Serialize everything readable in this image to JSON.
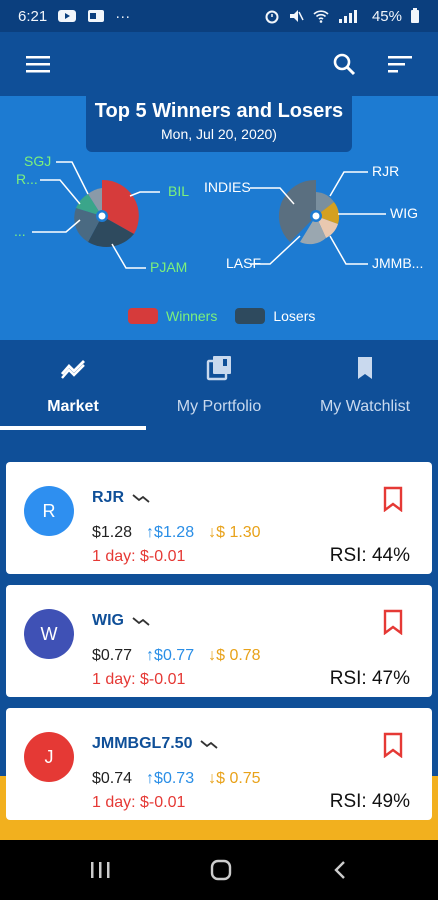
{
  "status": {
    "time": "6:21",
    "dots": "···",
    "battery": "45%"
  },
  "banner": {
    "title": "Top 5 Winners and Losers",
    "subtitle": "Mon, Jul 20, 2020)",
    "winners_labels": [
      "SGJ",
      "R...",
      "...",
      "BIL",
      "PJAM"
    ],
    "losers_labels": [
      "INDIES",
      "LASF",
      "RJR",
      "WIG",
      "JMMB..."
    ],
    "legend": [
      {
        "label": "Winners",
        "color": "#d63b3b",
        "text_color": "#7cf07c"
      },
      {
        "label": "Losers",
        "color": "#2e4a5e",
        "text_color": "#ffffff"
      }
    ]
  },
  "tabs": [
    {
      "label": "Market",
      "icon": "trending-icon",
      "active": true
    },
    {
      "label": "My Portfolio",
      "icon": "portfolio-icon",
      "active": false
    },
    {
      "label": "My Watchlist",
      "icon": "bookmark-icon",
      "active": false
    }
  ],
  "stocks": [
    {
      "initial": "R",
      "avatar_color": "#2e8ff0",
      "symbol": "RJR",
      "price": "$1.28",
      "up": "↑$1.28",
      "down": "↓$ 1.30",
      "change": "1 day: $-0.01",
      "rsi": "RSI: 44%"
    },
    {
      "initial": "W",
      "avatar_color": "#3f51b5",
      "symbol": "WIG",
      "price": "$0.77",
      "up": "↑$0.77",
      "down": "↓$ 0.78",
      "change": "1 day: $-0.01",
      "rsi": "RSI: 47%"
    },
    {
      "initial": "J",
      "avatar_color": "#e53935",
      "symbol": "JMMBGL7.50",
      "price": "$0.74",
      "up": "↑$0.73",
      "down": "↓$ 0.75",
      "change": "1 day: $-0.01",
      "rsi": "RSI: 49%"
    }
  ],
  "colors": {
    "accent": "#0f4f98",
    "banner": "#1d7bd2",
    "negative": "#e53935",
    "up": "#2a8ee6",
    "down": "#e8a21a"
  }
}
